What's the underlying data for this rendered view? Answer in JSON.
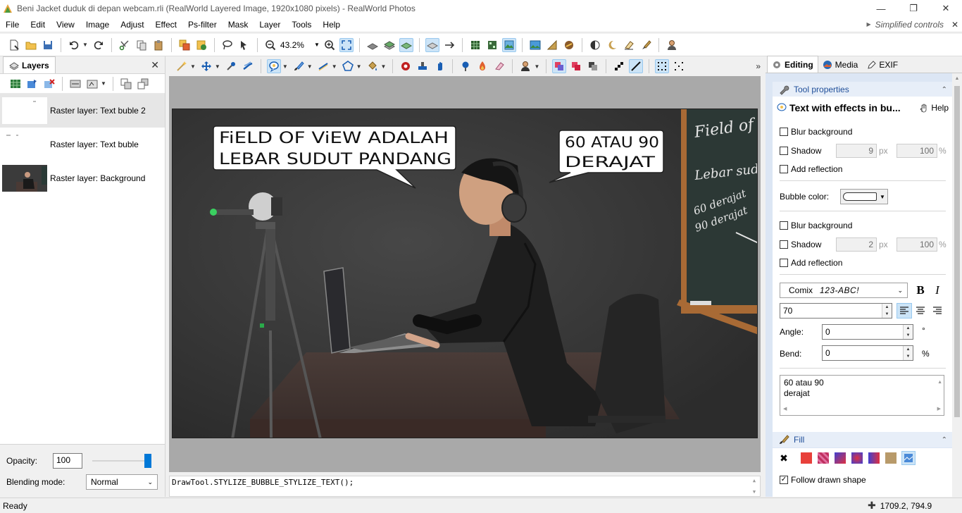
{
  "window": {
    "title": "Beni Jacket duduk di depan webcam.rli (RealWorld Layered Image, 1920x1080 pixels) - RealWorld Photos",
    "minimize": "—",
    "maximize": "❐",
    "close": "✕"
  },
  "menu": {
    "items": [
      "File",
      "Edit",
      "View",
      "Image",
      "Adjust",
      "Effect",
      "Ps-filter",
      "Mask",
      "Layer",
      "Tools",
      "Help"
    ],
    "simplified_controls": "Simplified controls",
    "close": "✕"
  },
  "toolbar": {
    "zoom": "43.2%"
  },
  "layers": {
    "tab_label": "Layers",
    "close": "✕",
    "items": [
      {
        "name": "Raster layer: Text buble 2",
        "selected": true
      },
      {
        "name": "Raster layer: Text buble",
        "selected": false
      },
      {
        "name": "Raster layer: Background",
        "selected": false
      }
    ],
    "opacity_label": "Opacity:",
    "opacity_value": "100",
    "opacity_fraction": 1.0,
    "blending_label": "Blending mode:",
    "blending_value": "Normal"
  },
  "canvas": {
    "bubble1_line1": "FiELD OF ViEW ADALAH",
    "bubble1_line2": "LEBAR SUDUT PANDANG",
    "bubble2_line1": "60 ATAU 90",
    "bubble2_line2": "DERAJAT",
    "board_line1": "Field of View",
    "board_line2": "Lebar sudut pan",
    "board_line3": "60 derajat",
    "board_line4": "90 derajat"
  },
  "console": {
    "text": "DrawTool.STYLIZE_BUBBLE_STYLIZE_TEXT();"
  },
  "right_panel": {
    "tabs": [
      "Editing",
      "Media",
      "EXIF"
    ],
    "tool_properties_header": "Tool properties",
    "tool_title": "Text with effects in bu...",
    "help": "Help",
    "blur_background_1": "Blur background",
    "shadow_1": "Shadow",
    "shadow_1_size": "9",
    "shadow_1_opacity": "100",
    "add_reflection_1": "Add reflection",
    "bubble_color_label": "Bubble color:",
    "blur_background_2": "Blur background",
    "shadow_2": "Shadow",
    "shadow_2_size": "2",
    "shadow_2_opacity": "100",
    "add_reflection_2": "Add reflection",
    "unit_px": "px",
    "unit_pct": "%",
    "font_name": "Comix",
    "font_preview": "123-ABC!",
    "bold": "B",
    "italic": "I",
    "font_size": "70",
    "angle_label": "Angle:",
    "angle_value": "0",
    "angle_unit": "°",
    "bend_label": "Bend:",
    "bend_value": "0",
    "bend_unit": "%",
    "text_line1": "60 atau 90",
    "text_line2": "derajat",
    "fill_header": "Fill",
    "follow_drawn_shape": "Follow drawn shape"
  },
  "status": {
    "text": "Ready",
    "coords": "1709.2, 794.9"
  },
  "colors": {
    "accent": "#0078d7",
    "panel_bg": "#dce6f4",
    "group_title": "#1f4e99"
  }
}
